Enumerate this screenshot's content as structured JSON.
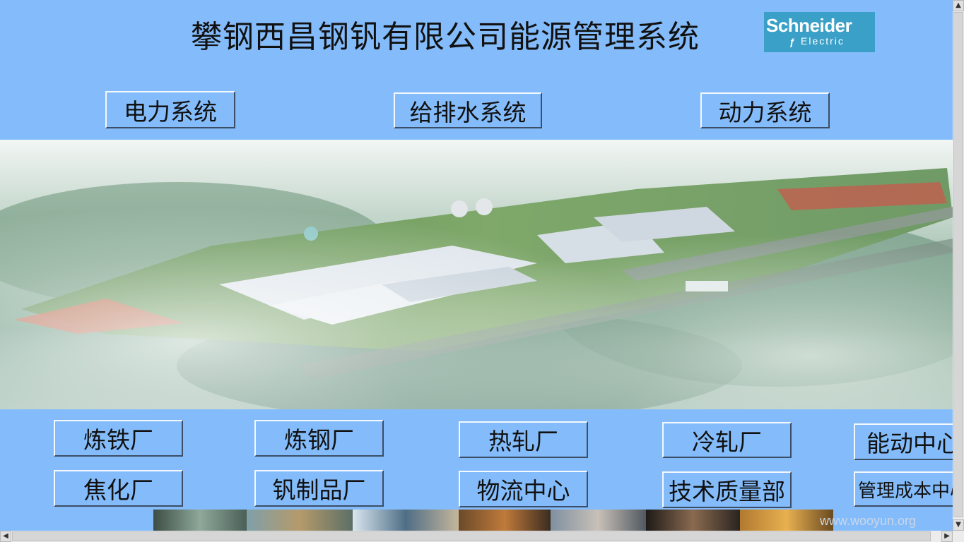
{
  "header": {
    "title": "攀钢西昌钢钒有限公司能源管理系统",
    "logo_text_top": "Schneider",
    "logo_text_bottom": "Electric",
    "logo_color": "#3aa0c7"
  },
  "system_buttons": [
    "电力系统",
    "给排水系统",
    "动力系统"
  ],
  "plant_buttons_row1": [
    "炼铁厂",
    "炼钢厂",
    "热轧厂",
    "冷轧厂",
    "能动中心"
  ],
  "plant_buttons_row2": [
    "焦化厂",
    "钒制品厂",
    "物流中心",
    "技术质量部",
    "管理成本中心"
  ],
  "watermark": "www.wooyun.org",
  "colors": {
    "background": "#84bcfb"
  }
}
